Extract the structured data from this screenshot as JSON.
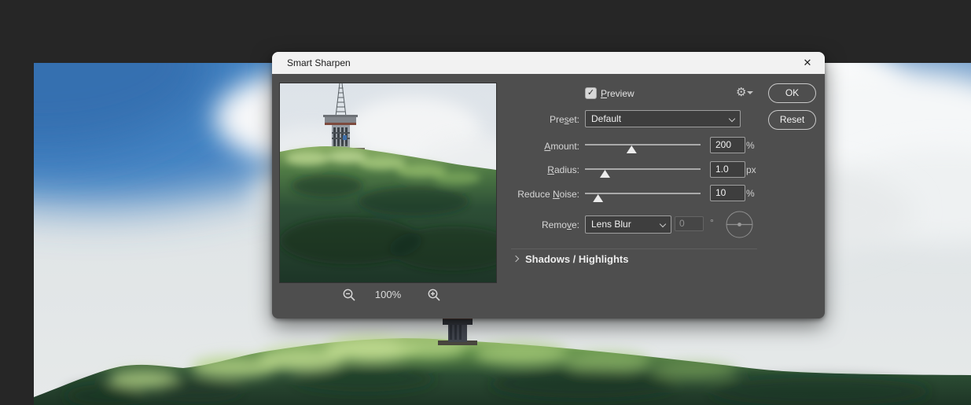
{
  "colors": {
    "app_background": "#262626",
    "dialog_body": "#4e4e4e",
    "titlebar": "#f2f2f2",
    "field_background": "#3e3e3e",
    "field_border": "#9e9e9e"
  },
  "dialog": {
    "title": "Smart Sharpen",
    "close_icon": "✕"
  },
  "preview_checkbox": {
    "check_icon": "✓",
    "checked": true,
    "label": {
      "pre": "",
      "key": "P",
      "post": "review"
    }
  },
  "gear_icon": "⚙",
  "buttons": {
    "ok": "OK",
    "reset": "Reset"
  },
  "preset": {
    "label": {
      "pre": "Pre",
      "key": "s",
      "post": "et:"
    },
    "value": "Default"
  },
  "sliders": [
    {
      "label": {
        "pre": "",
        "key": "A",
        "post": "mount:"
      },
      "value": "200",
      "unit": "%"
    },
    {
      "label": {
        "pre": "",
        "key": "R",
        "post": "adius:"
      },
      "value": "1.0",
      "unit": "px"
    },
    {
      "label": {
        "pre": "Reduce ",
        "key": "N",
        "post": "oise:"
      },
      "value": "10",
      "unit": "%"
    }
  ],
  "remove": {
    "label": {
      "pre": "Remo",
      "key": "v",
      "post": "e:"
    },
    "value": "Lens Blur",
    "angle_value": "0",
    "degree_symbol": "°"
  },
  "shadows_section": {
    "label": "Shadows / Highlights"
  },
  "zoom_controls": {
    "level": "100%"
  }
}
